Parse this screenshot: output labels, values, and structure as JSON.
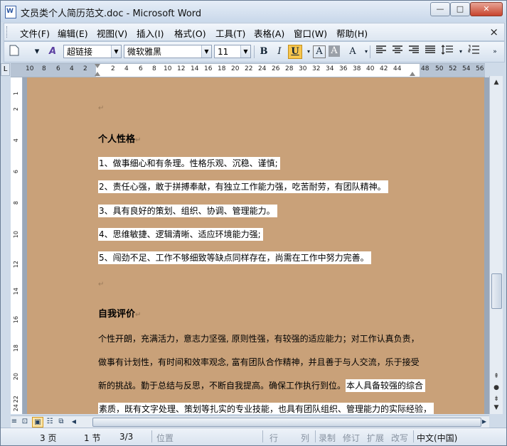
{
  "window": {
    "title": "文员类个人简历范文.doc - Microsoft Word",
    "app_icon_letter": "W"
  },
  "window_controls": {
    "minimize": "—",
    "maximize": "□",
    "close": "✕"
  },
  "menu": {
    "items": [
      "文件(F)",
      "编辑(E)",
      "视图(V)",
      "插入(I)",
      "格式(O)",
      "工具(T)",
      "表格(A)",
      "窗口(W)",
      "帮助(H)"
    ],
    "doc_close": "×"
  },
  "toolbar": {
    "style": "超链接",
    "font": "微软雅黑",
    "size": "11",
    "bold": "B",
    "italic": "I",
    "underline": "U",
    "font_color_a": "A",
    "char_shading_a": "A",
    "highlight_a": "A"
  },
  "ruler": {
    "numbers": [
      "10",
      "8",
      "6",
      "4",
      "2",
      "2",
      "4",
      "6",
      "8",
      "10",
      "12",
      "14",
      "16",
      "18",
      "20",
      "22",
      "24",
      "26",
      "28",
      "30",
      "32",
      "34",
      "36",
      "38",
      "40",
      "42",
      "44",
      "48",
      "50",
      "52",
      "54",
      "56"
    ],
    "vertical_numbers": [
      "1",
      "2",
      "4",
      "6",
      "8",
      "10",
      "12",
      "14",
      "16",
      "18",
      "20",
      "22",
      "24"
    ]
  },
  "document": {
    "empty_mark": "↵",
    "sections": [
      {
        "heading": "个人性格",
        "items": [
          "1、做事细心和有条理。性格乐观、沉稳、谨慎;",
          "2、责任心强，敢于拼搏奉献，有独立工作能力强，吃苦耐劳，有团队精神。",
          "3、具有良好的策划、组织、协调、管理能力。",
          "4、思维敏捷、逻辑清晰、适应环境能力强;",
          "5、闯劲不足、工作不够细致等缺点同样存在，尚需在工作中努力完善。"
        ]
      },
      {
        "heading": "自我评价",
        "lines": [
          "个性开朗，充满活力，意志力坚强, 原则性强，有较强的适应能力；对工作认真负责，",
          "做事有计划性，有时间和效率观念, 富有团队合作精神，并且善于与人交流，乐于接受",
          "新的挑战。勤于总结与反思，不断自我提高。确保工作执行到位。",
          "本人具备较强的综合",
          "素质，既有文字处理、策划等扎实的专业技能，也具有团队组织、管理能力的实际经验，"
        ]
      }
    ]
  },
  "status": {
    "page": "3 页",
    "section": "1 节",
    "pages": "3/3",
    "position": "位置",
    "line": "行",
    "column": "列",
    "rec": "录制",
    "trk": "修订",
    "ext": "扩展",
    "ovr": "改写",
    "language": "中文(中国)"
  },
  "colors": {
    "page_background": "#c9a179",
    "title_bar": "#c9d8ea"
  }
}
